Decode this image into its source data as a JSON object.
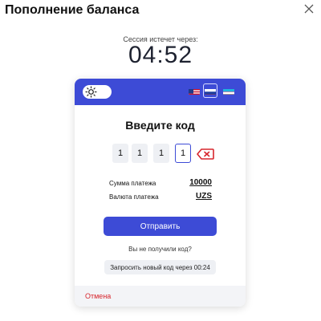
{
  "modal": {
    "title": "Пополнение баланса"
  },
  "session": {
    "label": "Сессия истечет через:",
    "timer": "04:52"
  },
  "card": {
    "title": "Введите код",
    "code_digits": [
      "1",
      "1",
      "1",
      "1"
    ],
    "payment_amount_label": "Сумма платежа",
    "payment_amount_value": "10000",
    "currency_label": "Валюта платежа",
    "currency_value": "UZS",
    "submit_label": "Отправить",
    "no_code_text": "Вы не получили код?",
    "resend_label": "Запросить новый код через 00:24",
    "cancel_label": "Отмена"
  },
  "header": {
    "theme_toggle_icon": "sun-icon",
    "languages": [
      "us-flag-icon",
      "ru-flag-icon",
      "uz-flag-icon"
    ],
    "selected_language": "ru-flag-icon"
  },
  "colors": {
    "accent": "#3d4bd6",
    "cancel": "#d7262d",
    "backspace": "#d7262d"
  }
}
